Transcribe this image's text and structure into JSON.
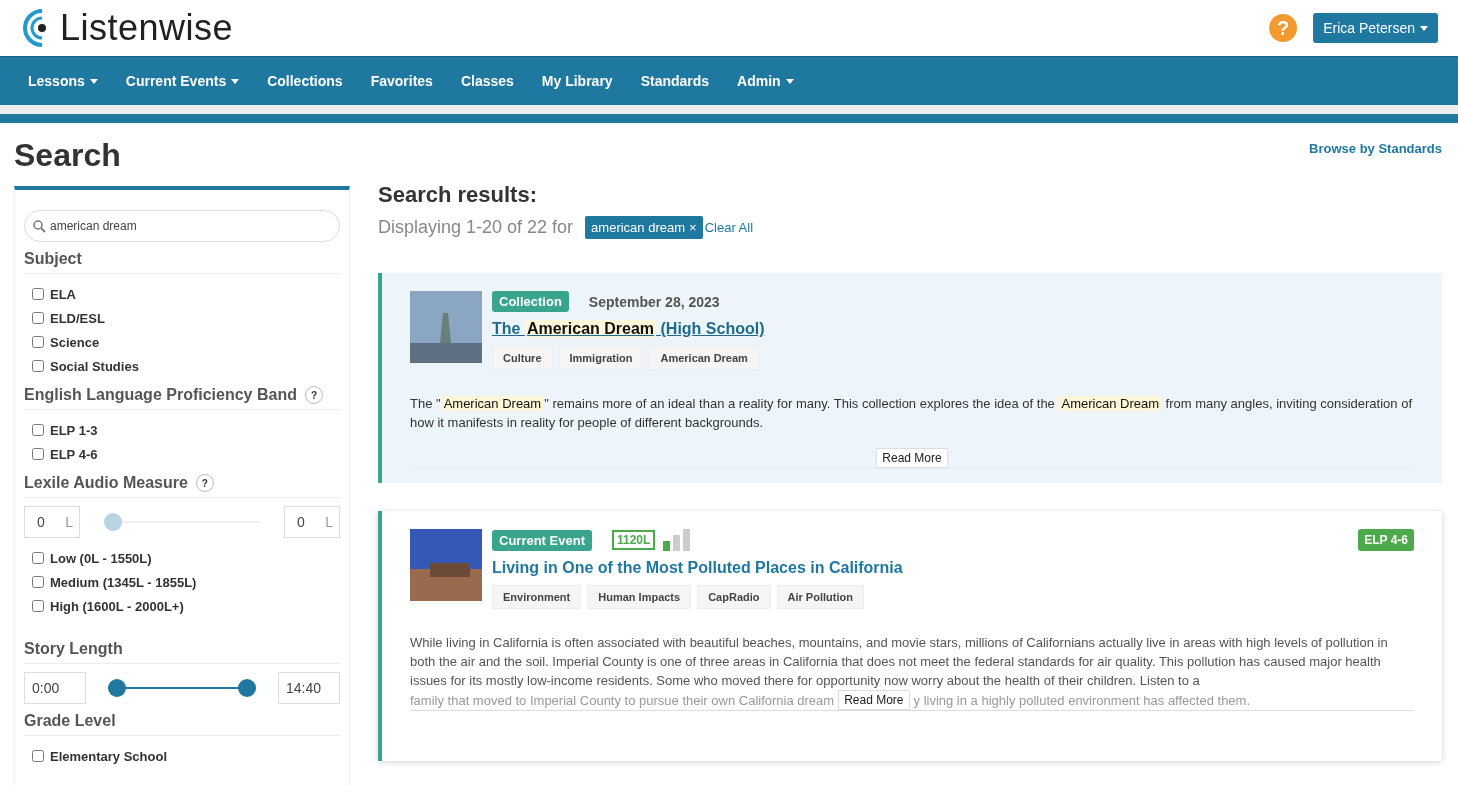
{
  "header": {
    "logo": "Listenwise",
    "help": "?",
    "user_menu": "Erica Petersen"
  },
  "nav": [
    {
      "label": "Lessons",
      "dropdown": true
    },
    {
      "label": "Current Events",
      "dropdown": true
    },
    {
      "label": "Collections",
      "dropdown": false
    },
    {
      "label": "Favorites",
      "dropdown": false
    },
    {
      "label": "Classes",
      "dropdown": false
    },
    {
      "label": "My Library",
      "dropdown": false
    },
    {
      "label": "Standards",
      "dropdown": false
    },
    {
      "label": "Admin",
      "dropdown": true
    }
  ],
  "page_title": "Search",
  "browse_link": "Browse by Standards",
  "sidebar": {
    "search": {
      "value": "american dream"
    },
    "sections": [
      {
        "kind": "checks",
        "title": "Subject",
        "options": [
          {
            "label": "ELA",
            "checked": false
          },
          {
            "label": "ELD/ESL",
            "checked": false
          },
          {
            "label": "Science",
            "checked": false
          },
          {
            "label": "Social Studies",
            "checked": false
          }
        ]
      },
      {
        "kind": "checks",
        "title": "English Language Proficiency Band",
        "help": "?",
        "options": [
          {
            "label": "ELP 1-3",
            "checked": false
          },
          {
            "label": "ELP 4-6",
            "checked": false
          }
        ]
      },
      {
        "kind": "lexile",
        "title": "Lexile Audio Measure",
        "help": "?",
        "min": "0",
        "min_unit": "L",
        "max": "0",
        "max_unit": "L",
        "handles": [
          {
            "level": 0
          }
        ],
        "options": [
          {
            "label": "Low (0L - 1550L)",
            "checked": false
          },
          {
            "label": "Medium (1345L - 1855L)",
            "checked": false
          },
          {
            "label": "High (1600L - 2000L+)",
            "checked": false
          }
        ]
      },
      {
        "kind": "range",
        "title": "Story Length",
        "min": "0:00",
        "max": "14:40",
        "handles": [
          {
            "level": 0
          },
          {
            "level": 1
          }
        ]
      },
      {
        "kind": "checks",
        "title": "Grade Level",
        "options": [
          {
            "label": "Elementary School",
            "checked": false
          }
        ]
      }
    ]
  },
  "results": {
    "heading": "Search results:",
    "summary": "Displaying 1-20 of 22 for",
    "filter_chip": "american dream",
    "chip_remove": "×",
    "clear_all": "Clear All",
    "items": [
      {
        "kind": "collection",
        "highlighted": true,
        "type_label": "Collection",
        "date": "September 28, 2023",
        "title": "The **American Dream** (High School)",
        "tags": [
          "Culture",
          "Immigration",
          "American Dream"
        ],
        "description": "The \"**American Dream**\" remains more of an ideal than a reality for many. This collection explores the idea of the **American Dream** from many angles, inviting consideration of how it manifests in reality for people of different backgrounds.",
        "read_more": "Read More"
      },
      {
        "kind": "current_event",
        "highlighted": false,
        "type_label": "Current Event",
        "lexile": "1120L",
        "elp": "ELP 4-6",
        "title": "Living in One of the Most Polluted Places in California",
        "tags": [
          "Environment",
          "Human Impacts",
          "CapRadio",
          "Air Pollution"
        ],
        "description": "While living in California is often associated with beautiful beaches, mountains, and movie stars, millions of Californians actually live in areas with high levels of pollution in both the air and the soil. Imperial County is one of three areas in California that does not meet the federal standards for air quality. This pollution has caused major health issues for its mostly low-income residents. Some who moved there for opportunity now worry about the health of their children. Listen to a",
        "description_before_button": "family that moved to Imperial County to pursue their own California dream",
        "description_after_button": "y living in a highly polluted environment has affected them.",
        "read_more": "Read More"
      }
    ]
  }
}
